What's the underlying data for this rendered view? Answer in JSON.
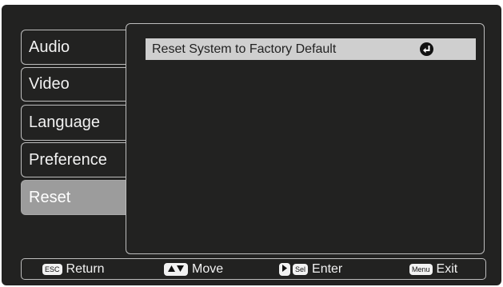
{
  "menu": {
    "tabs": [
      {
        "label": "Audio",
        "active": false
      },
      {
        "label": "Video",
        "active": false
      },
      {
        "label": "Language",
        "active": false
      },
      {
        "label": "Preference",
        "active": false
      },
      {
        "label": "Reset",
        "active": true
      }
    ]
  },
  "panel": {
    "items": [
      {
        "label": "Reset System to Factory Default",
        "icon": "enter-icon"
      }
    ]
  },
  "footer": {
    "esc_key": "ESC",
    "return_label": "Return",
    "move_label": "Move",
    "sel_key": "Sel",
    "enter_label": "Enter",
    "menu_key": "Menu",
    "exit_label": "Exit"
  },
  "colors": {
    "background": "#222221",
    "active_tab": "#9c9c9c",
    "highlight_row": "#cfcfcf",
    "border": "#bdbdbd"
  }
}
